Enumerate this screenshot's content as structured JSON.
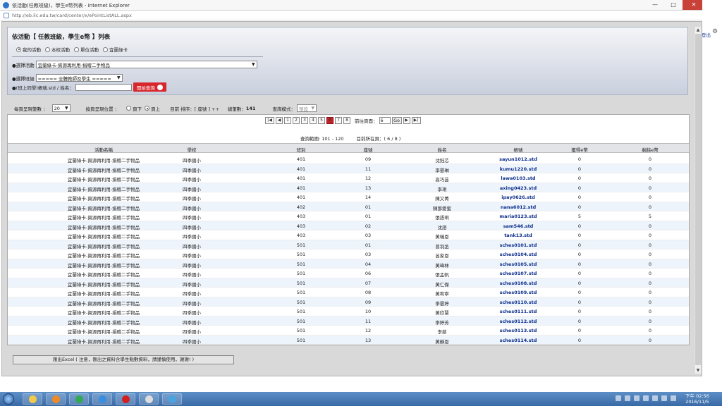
{
  "window": {
    "title": "依活動(任教班級)，學生e幣列表 - Internet Explorer",
    "url": "http://eb.ilc.edu.tw/card/center/x/ePointListALL.aspx",
    "buttons": [
      "—",
      "□",
      "✕"
    ]
  },
  "right_strip": {
    "logout": "登出"
  },
  "panel": {
    "title": "依活動【 任教班級，學生e幣 】列表",
    "radios": [
      {
        "label": "我的活動",
        "checked": true
      },
      {
        "label": "本校活動",
        "checked": false
      },
      {
        "label": "單位活動",
        "checked": false
      },
      {
        "label": "宜蘭綠卡",
        "checked": false
      }
    ],
    "activity_label": "●選擇活動",
    "activity_value": "宜蘭綠卡-資源再利用-捐贈二手物品",
    "class_label": "●選擇班級",
    "class_value": "===== 全體教師及學生 =====",
    "student_label": "●(班上同學)帳號.std / 姓名：",
    "query_button": "開始查詢"
  },
  "toolbar": {
    "per_page_label": "每頁呈現筆數 ：",
    "per_page_value": "20",
    "pager_pos_label": "換頁呈現位置 ：",
    "pos_options": [
      {
        "label": "頁下",
        "checked": false
      },
      {
        "label": "頁上",
        "checked": true
      }
    ],
    "sort_label": "目前 排序：[ 座號 ] ++",
    "total_label": "總筆數：",
    "total_value": "141",
    "mode_label": "查詢模式：",
    "mode_value": "預設"
  },
  "pager": {
    "first": "|◀",
    "prev": "◀",
    "pages": [
      "1",
      "2",
      "3",
      "4",
      "5",
      "6",
      "7",
      "8"
    ],
    "current_index": 5,
    "next": "▶",
    "last": "▶|",
    "goto_label": "前往頁面：",
    "goto_value": "6",
    "go": "Go"
  },
  "range": {
    "text": "查詢範圍: 101 - 120",
    "page_text": "目前所在頁：( 6 / 8 )"
  },
  "table": {
    "columns": [
      "活動名稱",
      "學校",
      "班別",
      "座號",
      "姓名",
      "帳號",
      "獲得e幣",
      "剩餘e幣"
    ],
    "rows": [
      [
        "宜蘭綠卡-資源再利用-捐贈二手物品",
        "四季國小",
        "401",
        "09",
        "沈鈺芯",
        "sayun1012.std",
        "0",
        "0"
      ],
      [
        "宜蘭綠卡-資源再利用-捐贈二手物品",
        "四季國小",
        "401",
        "11",
        "李晏琳",
        "kumu1220.std",
        "0",
        "0"
      ],
      [
        "宜蘭綠卡-資源再利用-捐贈二手物品",
        "四季國小",
        "401",
        "12",
        "高巧芸",
        "lawa0103.std",
        "0",
        "0"
      ],
      [
        "宜蘭綠卡-資源再利用-捐贈二手物品",
        "四季國小",
        "401",
        "13",
        "李琍",
        "axing0423.std",
        "0",
        "0"
      ],
      [
        "宜蘭綠卡-資源再利用-捐贈二手物品",
        "四季國小",
        "401",
        "14",
        "陳又菁",
        "ipay0626.std",
        "0",
        "0"
      ],
      [
        "宜蘭綠卡-資源再利用-捐贈二手物品",
        "四季國小",
        "402",
        "01",
        "陳那愛蜜",
        "nana6012.std",
        "0",
        "0"
      ],
      [
        "宜蘭綠卡-資源再利用-捐贈二手物品",
        "四季國小",
        "403",
        "01",
        "張語琍",
        "maria0123.std",
        "5",
        "5"
      ],
      [
        "宜蘭綠卡-資源再利用-捐贈二手物品",
        "四季國小",
        "403",
        "02",
        "沈語",
        "sam546.std",
        "0",
        "0"
      ],
      [
        "宜蘭綠卡-資源再利用-捐贈二手物品",
        "四季國小",
        "403",
        "03",
        "黃瑞恩",
        "tank13.std",
        "0",
        "0"
      ],
      [
        "宜蘭綠卡-資源再利用-捐贈二手物品",
        "四季國小",
        "501",
        "01",
        "曾羽丞",
        "sches0101.std",
        "0",
        "0"
      ],
      [
        "宜蘭綠卡-資源再利用-捐贈二手物品",
        "四季國小",
        "501",
        "03",
        "呂家恩",
        "sches0104.std",
        "0",
        "0"
      ],
      [
        "宜蘭綠卡-資源再利用-捐贈二手物品",
        "四季國小",
        "501",
        "04",
        "黃瑋林",
        "sches0105.std",
        "0",
        "0"
      ],
      [
        "宜蘭綠卡-資源再利用-捐贈二手物品",
        "四季國小",
        "501",
        "06",
        "張孟帆",
        "sches0107.std",
        "0",
        "0"
      ],
      [
        "宜蘭綠卡-資源再利用-捐贈二手物品",
        "四季國小",
        "501",
        "07",
        "黃仁傑",
        "sches0108.std",
        "0",
        "0"
      ],
      [
        "宜蘭綠卡-資源再利用-捐贈二手物品",
        "四季國小",
        "501",
        "08",
        "黃宥寧",
        "sches0109.std",
        "0",
        "0"
      ],
      [
        "宜蘭綠卡-資源再利用-捐贈二手物品",
        "四季國小",
        "501",
        "09",
        "李晏婷",
        "sches0110.std",
        "0",
        "0"
      ],
      [
        "宜蘭綠卡-資源再利用-捐贈二手物品",
        "四季國小",
        "501",
        "10",
        "黃欣慧",
        "sches0111.std",
        "0",
        "0"
      ],
      [
        "宜蘭綠卡-資源再利用-捐贈二手物品",
        "四季國小",
        "501",
        "11",
        "李婷芳",
        "sches0112.std",
        "0",
        "0"
      ],
      [
        "宜蘭綠卡-資源再利用-捐贈二手物品",
        "四季國小",
        "501",
        "12",
        "李慈",
        "sches0113.std",
        "0",
        "0"
      ],
      [
        "宜蘭綠卡-資源再利用-捐贈二手物品",
        "四季國小",
        "501",
        "13",
        "黃靜恩",
        "sches0114.std",
        "0",
        "0"
      ]
    ]
  },
  "export_button": "匯出Excel ( 注意，匯出之資料含學生點數資料，請謹慎使用，謝謝! )",
  "taskbar": {
    "apps": [
      {
        "icon": "explorer-icon",
        "color": "#f2c94c"
      },
      {
        "icon": "media-player-icon",
        "color": "#f08a24"
      },
      {
        "icon": "chrome-icon",
        "color": "#34a853"
      },
      {
        "icon": "ie-icon",
        "color": "#3b8de0"
      },
      {
        "icon": "opera-icon",
        "color": "#d12020"
      },
      {
        "icon": "tool-icon",
        "color": "#dddddd"
      },
      {
        "icon": "app-icon",
        "color": "#4aa3df"
      }
    ],
    "time": "下午 02:56",
    "date": "2016/11/5"
  }
}
